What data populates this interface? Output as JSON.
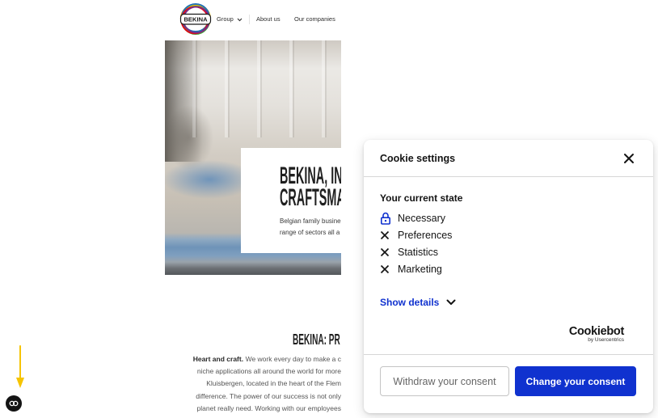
{
  "site": {
    "logo_text": "BEKINA",
    "nav": {
      "group": "Group",
      "group_icon": "chevron-down-icon",
      "about": "About us",
      "companies": "Our companies"
    },
    "hero": {
      "title_lines": [
        "BEKINA, IN",
        "CRAFTSMA"
      ],
      "text_lines": [
        "Belgian family busine",
        "range of sectors all a"
      ]
    },
    "intro": {
      "heading": "BEKINA: PR",
      "lead": "Heart and craft.",
      "lines": [
        "We work every day to make a c",
        "niche applications all around the world for more",
        "Kluisbergen, located in the heart of the Flem",
        "difference. The power of our success is not only",
        "planet really need. Working with our employees"
      ]
    }
  },
  "cookie_widget": {
    "icon": "cookie-icon"
  },
  "cookie_dialog": {
    "title": "Cookie settings",
    "close_icon": "close-icon",
    "state_heading": "Your current state",
    "categories": [
      {
        "label": "Necessary",
        "icon": "lock-icon"
      },
      {
        "label": "Preferences",
        "icon": "x-icon"
      },
      {
        "label": "Statistics",
        "icon": "x-icon"
      },
      {
        "label": "Marketing",
        "icon": "x-icon"
      }
    ],
    "show_details": "Show details",
    "show_details_icon": "chevron-down-icon",
    "branding": {
      "name": "Cookiebot",
      "byline": "by Usercentrics"
    },
    "buttons": {
      "withdraw": "Withdraw your consent",
      "change": "Change your consent"
    }
  },
  "colors": {
    "accent": "#1032cf",
    "text": "#141414",
    "annotation_arrow": "#f6c400"
  }
}
